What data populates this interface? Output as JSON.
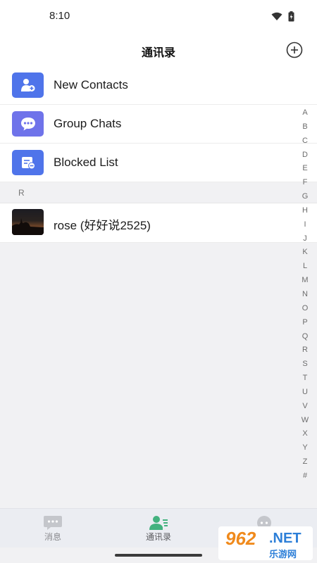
{
  "status_bar": {
    "time": "8:10"
  },
  "header": {
    "title": "通讯录"
  },
  "menu_items": [
    {
      "label": "New Contacts",
      "icon": "add-contact-icon",
      "color": "#4f74ea"
    },
    {
      "label": "Group Chats",
      "icon": "chat-bubble-icon",
      "color": "#6f73ea"
    },
    {
      "label": "Blocked List",
      "icon": "blocked-list-icon",
      "color": "#4f74ea"
    }
  ],
  "sections": [
    {
      "letter": "R",
      "contacts": [
        {
          "name": "rose (好好说2525)"
        }
      ]
    }
  ],
  "index_letters": [
    "A",
    "B",
    "C",
    "D",
    "E",
    "F",
    "G",
    "H",
    "I",
    "J",
    "K",
    "L",
    "M",
    "N",
    "O",
    "P",
    "Q",
    "R",
    "S",
    "T",
    "U",
    "V",
    "W",
    "X",
    "Y",
    "Z",
    "#"
  ],
  "tabs": [
    {
      "label": "消息",
      "icon": "message-icon",
      "active": false
    },
    {
      "label": "通讯录",
      "icon": "contacts-icon",
      "active": true
    },
    {
      "label": "",
      "icon": "discover-icon",
      "active": false
    }
  ],
  "watermark": {
    "number": "962",
    "suffix": ".NET",
    "cn": "乐游网"
  },
  "colors": {
    "accent": "#4f74ea",
    "active_tab": "#43b27f"
  }
}
